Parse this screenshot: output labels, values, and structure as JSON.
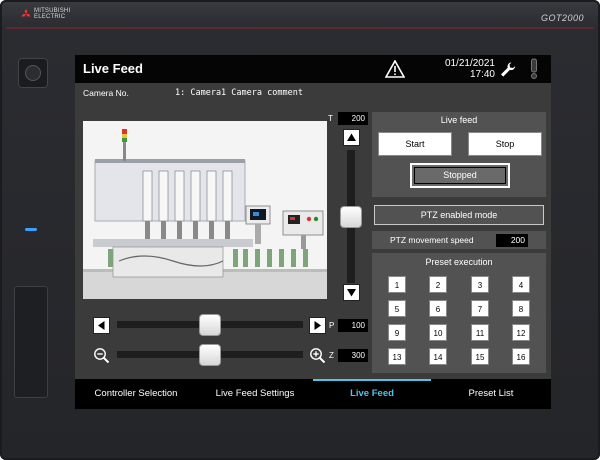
{
  "device": {
    "brand": "MITSUBISHI\nELECTRIC",
    "model": "GOT2000",
    "logo": "mitsubishi-three-diamonds"
  },
  "header": {
    "title": "Live Feed",
    "date": "01/21/2021",
    "time": "17:40",
    "icons": [
      "warning-icon",
      "wrench-icon",
      "exclamation-icon"
    ]
  },
  "camera_bar": {
    "label": "Camera No.",
    "value": "1: Camera1 Camera comment"
  },
  "controls": {
    "tilt": {
      "label": "T",
      "value": "200",
      "level": 0.5
    },
    "pan": {
      "label": "P",
      "value": "100",
      "level": 0.5
    },
    "zoom": {
      "label": "Z",
      "value": "300",
      "level": 0.5
    }
  },
  "live_feed_panel": {
    "heading": "Live feed",
    "start_label": "Start",
    "stop_label": "Stop",
    "status": "Stopped"
  },
  "ptz": {
    "mode_label": "PTZ enabled mode",
    "speed_label": "PTZ movement speed",
    "speed_value": "200"
  },
  "preset": {
    "heading": "Preset execution",
    "buttons": [
      "1",
      "2",
      "3",
      "4",
      "5",
      "6",
      "7",
      "8",
      "9",
      "10",
      "11",
      "12",
      "13",
      "14",
      "15",
      "16"
    ]
  },
  "nav": {
    "items": [
      {
        "label": "Controller Selection"
      },
      {
        "label": "Live Feed Settings"
      },
      {
        "label": "Live Feed",
        "active": true
      },
      {
        "label": "Preset List"
      }
    ]
  },
  "colors": {
    "accent": "#4fc3e8",
    "screen_bg": "#3b3b3b",
    "panel_bg": "#525252"
  }
}
